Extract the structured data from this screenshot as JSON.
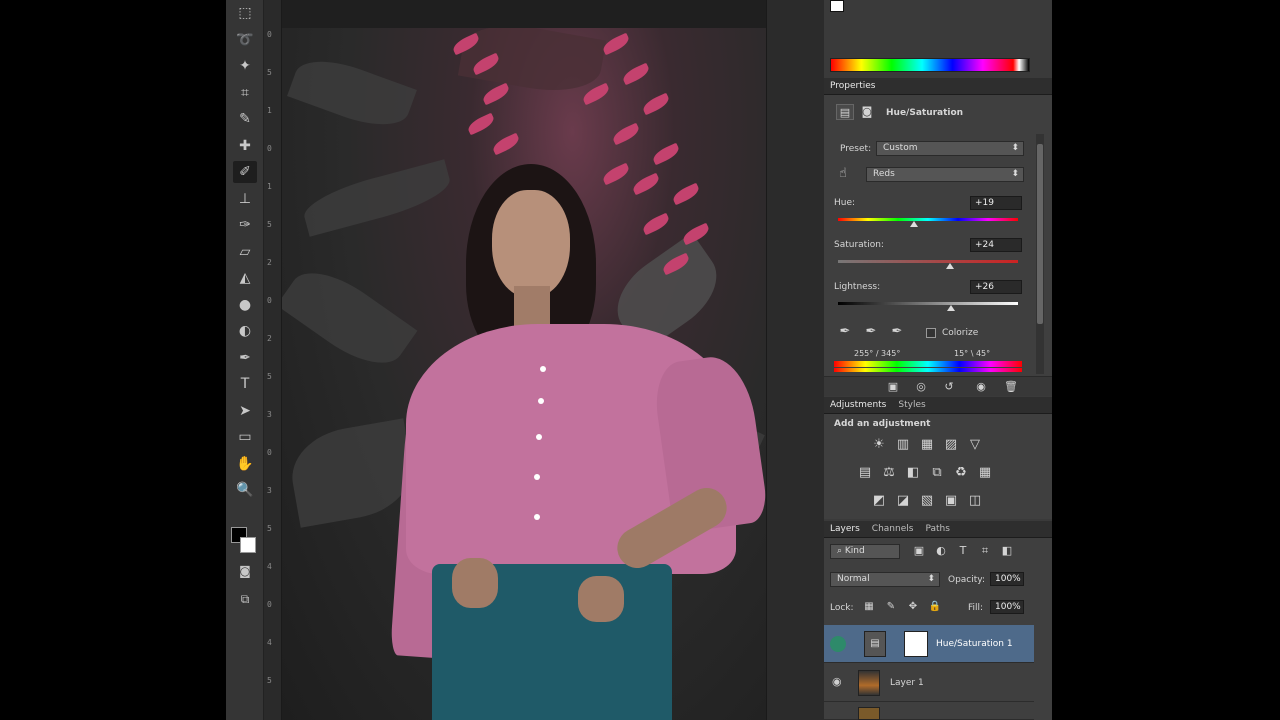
{
  "tools": [
    "marquee-icon",
    "lasso-icon",
    "magic-wand-icon",
    "crop-icon",
    "eyedropper-icon",
    "healing-icon",
    "brush-icon",
    "stamp-icon",
    "history-brush-icon",
    "eraser-icon",
    "paint-bucket-icon",
    "blur-icon",
    "dodge-icon",
    "pen-icon",
    "type-icon",
    "path-select-icon",
    "rectangle-icon",
    "hand-icon",
    "zoom-icon"
  ],
  "tool_glyphs": [
    "⬚",
    "➰",
    "✦",
    "⌗",
    "✎",
    "✚",
    "✐",
    "⊥",
    "✑",
    "▱",
    "◭",
    "●",
    "◐",
    "✒",
    "T",
    "➤",
    "▭",
    "✋",
    "🔍"
  ],
  "ruler_ticks": [
    "0",
    "5",
    "1",
    "0",
    "1",
    "5",
    "2",
    "0",
    "2",
    "5",
    "3",
    "0",
    "3",
    "5",
    "4",
    "0",
    "4",
    "5"
  ],
  "properties": {
    "tab": "Properties",
    "title": "Hue/Saturation",
    "preset_label": "Preset:",
    "preset_value": "Custom",
    "range_value": "Reds",
    "hue_label": "Hue:",
    "hue_value": "+19",
    "hue_level": 0.42,
    "saturation_label": "Saturation:",
    "saturation_value": "+24",
    "saturation_level": 0.62,
    "lightness_label": "Lightness:",
    "lightness_value": "+26",
    "lightness_level": 0.63,
    "colorize_label": "Colorize",
    "range_left": "255° / 345°",
    "range_right": "15° \\ 45°"
  },
  "adjustments": {
    "tabs": [
      "Adjustments",
      "Styles"
    ],
    "heading": "Add an adjustment",
    "row1": [
      "☀",
      "▥",
      "▦",
      "▨",
      "▽"
    ],
    "row2": [
      "▤",
      "⚖",
      "◧",
      "⧉",
      "♻",
      "▦"
    ],
    "row3": [
      "◩",
      "◪",
      "▧",
      "▣",
      "◫"
    ]
  },
  "layers": {
    "tabs": [
      "Layers",
      "Channels",
      "Paths"
    ],
    "filter_label": "Kind",
    "blend_mode": "Normal",
    "opacity_label": "Opacity:",
    "opacity_value": "100%",
    "lock_label": "Lock:",
    "fill_label": "Fill:",
    "fill_value": "100%",
    "items": [
      {
        "name": "Hue/Saturation 1",
        "selected": true
      },
      {
        "name": "Layer 1",
        "selected": false
      }
    ]
  },
  "colors": {
    "accent": "#4e6a8a",
    "shirt": "#c2729d",
    "flower": "#c4426e"
  }
}
